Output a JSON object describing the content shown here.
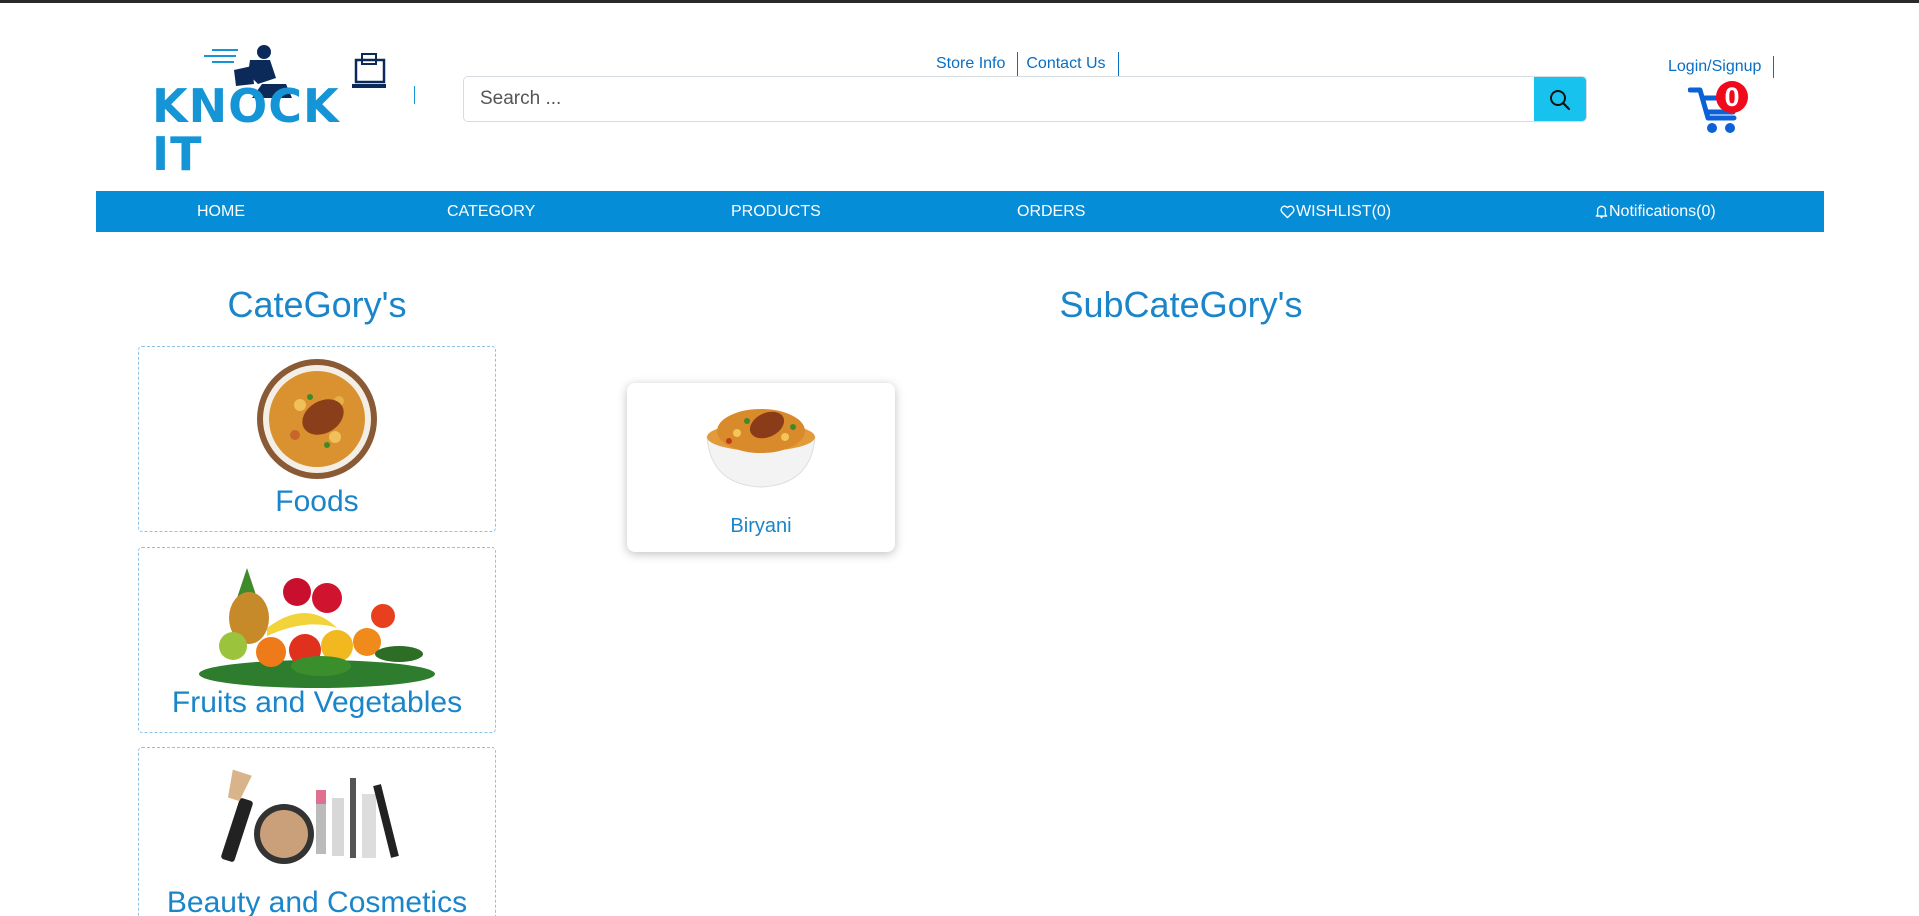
{
  "brand": {
    "logo_text": "KNOCK IT"
  },
  "top_links": [
    "Store Info",
    "Contact Us"
  ],
  "search": {
    "placeholder": "Search ...",
    "value": ""
  },
  "account": {
    "login_label": "Login/Signup",
    "cart_count": "0"
  },
  "nav": {
    "home": "HOME",
    "category": "CATEGORY",
    "products": "PRODUCTS",
    "orders": "ORDERS",
    "wishlist": "WISHLIST(0)",
    "notifications": "Notifications(0)"
  },
  "categories": {
    "heading": "CateGory's",
    "items": [
      {
        "label": "Foods",
        "icon": "biryani-plate-image"
      },
      {
        "label": "Fruits and Vegetables",
        "icon": "fruits-vegetables-image"
      },
      {
        "label": "Beauty and Cosmetics",
        "icon": "cosmetics-image"
      }
    ]
  },
  "subcategories": {
    "heading": "SubCateGory's",
    "items": [
      {
        "label": "Biryani",
        "icon": "biryani-bowl-image"
      }
    ]
  },
  "colors": {
    "primary": "#068dd8",
    "heading": "#1a85c9",
    "search_button": "#17c2ee",
    "badge": "#ef0b1c"
  }
}
